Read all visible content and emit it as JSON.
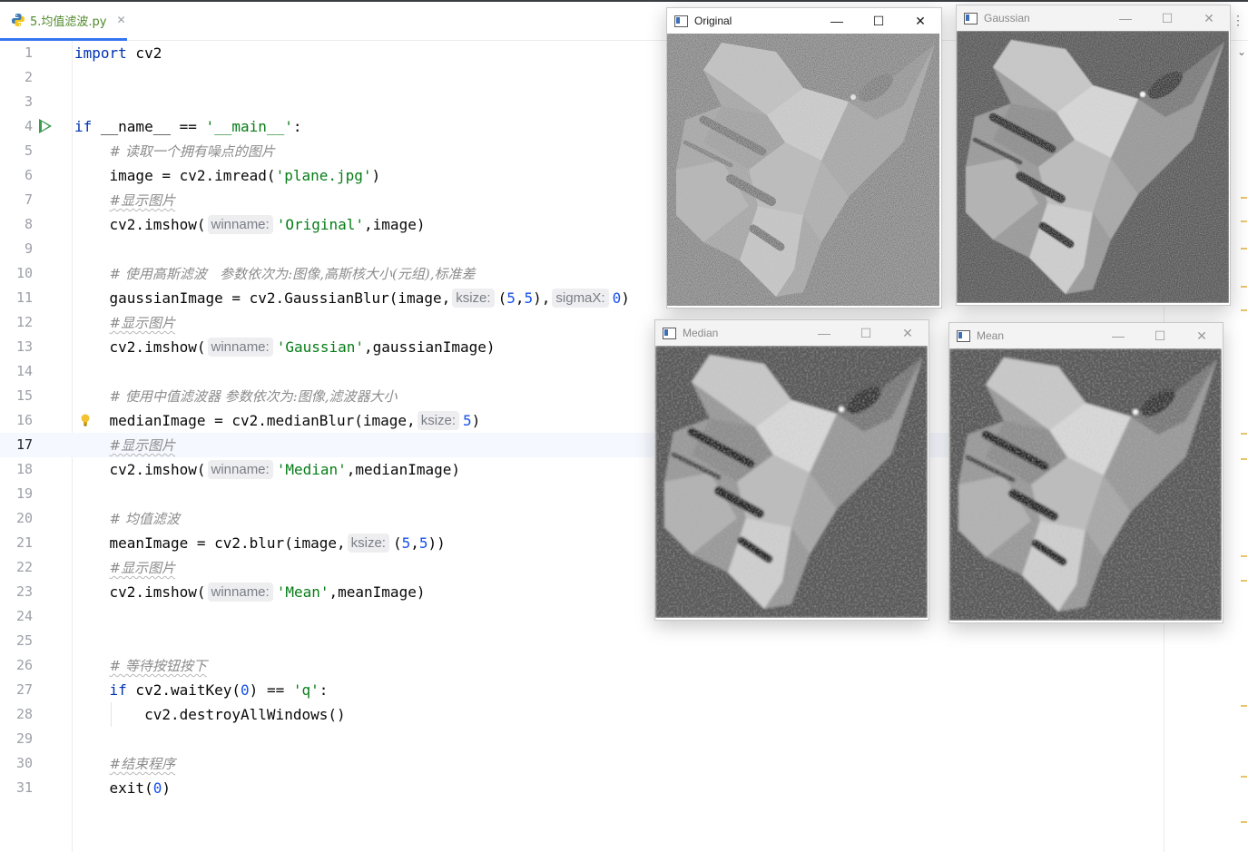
{
  "tab": {
    "filename": "5.均值滤波.py"
  },
  "editor": {
    "current_line": 17,
    "lines": [
      {
        "n": "1",
        "html": "<span class=\"kw\">import</span> cv2"
      },
      {
        "n": "2",
        "html": ""
      },
      {
        "n": "3",
        "html": ""
      },
      {
        "n": "4",
        "html": "<span class=\"kw\">if</span> __name__ == <span class=\"str\">'__main__'</span>:"
      },
      {
        "n": "5",
        "html": "    <span class=\"cmt\"># 读取一个拥有噪点的图片</span>"
      },
      {
        "n": "6",
        "html": "    image = cv2.imread(<span class=\"str\">'plane.jpg'</span>)"
      },
      {
        "n": "7",
        "html": "    <span class=\"cmt cmt-u\">#显示图片</span>"
      },
      {
        "n": "8",
        "html": "    cv2.imshow(<span class=\"hint\">winname:</span><span class=\"str\">'Original'</span>,image)"
      },
      {
        "n": "9",
        "html": ""
      },
      {
        "n": "10",
        "html": "    <span class=\"cmt\"># 使用高斯滤波   参数依次为:图像,高斯核大小(元组),标准差</span>"
      },
      {
        "n": "11",
        "html": "    gaussianImage = cv2.GaussianBlur(image,<span class=\"hint\">ksize:</span>(<span class=\"num\">5</span>,<span class=\"num\">5</span>),<span class=\"hint\">sigmaX:</span><span class=\"num\">0</span>)"
      },
      {
        "n": "12",
        "html": "    <span class=\"cmt cmt-u\">#显示图片</span>"
      },
      {
        "n": "13",
        "html": "    cv2.imshow(<span class=\"hint\">winname:</span><span class=\"str\">'Gaussian'</span>,gaussianImage)"
      },
      {
        "n": "14",
        "html": ""
      },
      {
        "n": "15",
        "html": "    <span class=\"cmt\"># 使用中值滤波器 参数依次为:图像,滤波器大小</span>"
      },
      {
        "n": "16",
        "html": "    medianImage = cv2.medianBlur(image,<span class=\"hint\">ksize:</span><span class=\"num\">5</span>)"
      },
      {
        "n": "17",
        "html": "    <span class=\"cmt cmt-u\">#显示图片</span>"
      },
      {
        "n": "18",
        "html": "    cv2.imshow(<span class=\"hint\">winname:</span><span class=\"str\">'Median'</span>,medianImage)"
      },
      {
        "n": "19",
        "html": ""
      },
      {
        "n": "20",
        "html": "    <span class=\"cmt\"># 均值滤波</span>"
      },
      {
        "n": "21",
        "html": "    meanImage = cv2.blur(image,<span class=\"hint\">ksize:</span>(<span class=\"num\">5</span>,<span class=\"num\">5</span>))"
      },
      {
        "n": "22",
        "html": "    <span class=\"cmt cmt-u\">#显示图片</span>"
      },
      {
        "n": "23",
        "html": "    cv2.imshow(<span class=\"hint\">winname:</span><span class=\"str\">'Mean'</span>,meanImage)"
      },
      {
        "n": "24",
        "html": ""
      },
      {
        "n": "25",
        "html": ""
      },
      {
        "n": "26",
        "html": "    <span class=\"cmt cmt-u\"># 等待按钮按下</span>"
      },
      {
        "n": "27",
        "html": "    <span class=\"kw\">if</span> cv2.waitKey(<span class=\"num\">0</span>) == <span class=\"str\">'q'</span>:"
      },
      {
        "n": "28",
        "html": "        cv2.destroyAllWindows()"
      },
      {
        "n": "29",
        "html": ""
      },
      {
        "n": "30",
        "html": "    <span class=\"cmt cmt-u\">#结束程序</span>"
      },
      {
        "n": "31",
        "html": "    exit(<span class=\"num\">0</span>)"
      }
    ]
  },
  "windows": [
    {
      "key": "original",
      "title": "Original",
      "active": true,
      "btn_min": "—",
      "btn_max": "☐",
      "btn_close": "✕"
    },
    {
      "key": "gaussian",
      "title": "Gaussian",
      "active": false,
      "btn_min": "—",
      "btn_max": "☐",
      "btn_close": "✕"
    },
    {
      "key": "median",
      "title": "Median",
      "active": false,
      "btn_min": "—",
      "btn_max": "☐",
      "btn_close": "✕"
    },
    {
      "key": "mean",
      "title": "Mean",
      "active": false,
      "btn_min": "—",
      "btn_max": "☐",
      "btn_close": "✕"
    }
  ],
  "icons": {
    "python": "python-file-icon",
    "run": "run-icon",
    "bulb": "lightbulb-icon",
    "kebab": "more-options-icon"
  },
  "colors": {
    "keyword": "#0033b3",
    "string": "#067d17",
    "number": "#1750eb",
    "comment": "#8c8c8c",
    "tab_accent": "#3574f0",
    "run_green": "#3b9a4d"
  }
}
